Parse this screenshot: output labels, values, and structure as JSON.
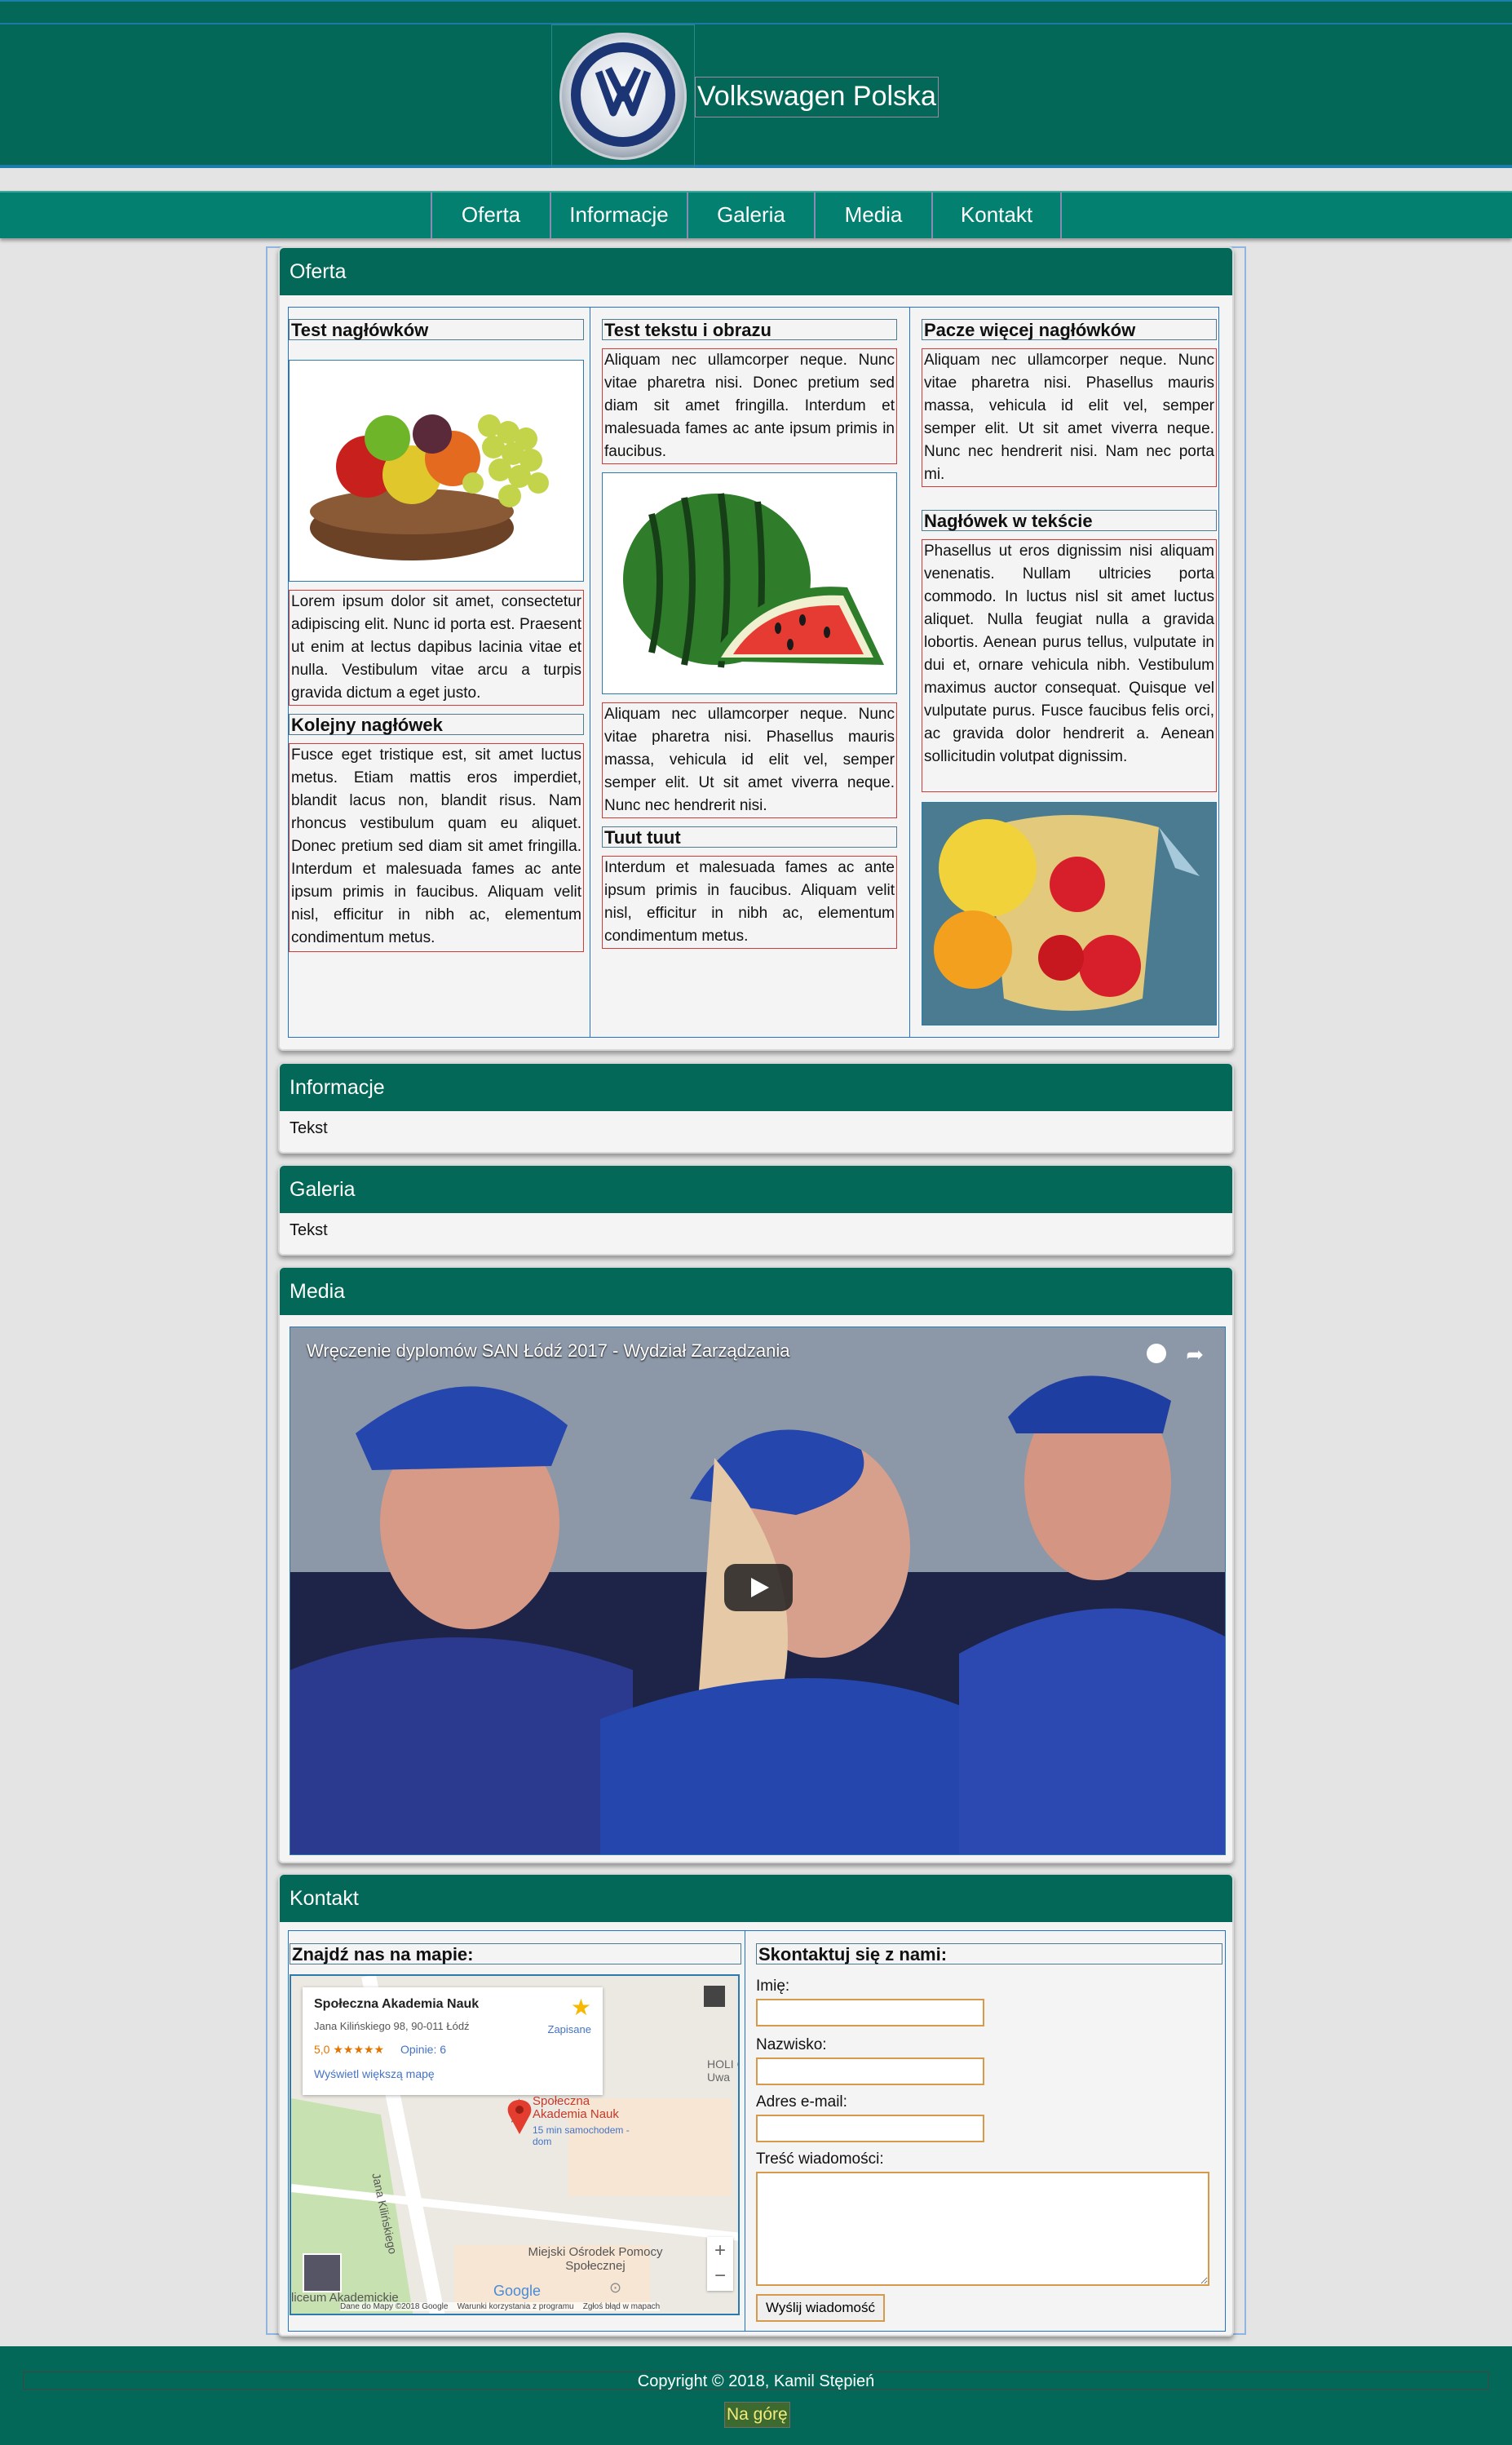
{
  "header": {
    "title": "Volkswagen Polska",
    "logo_letter": "VW"
  },
  "nav": {
    "items": [
      "Oferta",
      "Informacje",
      "Galeria",
      "Media",
      "Kontakt"
    ]
  },
  "oferta": {
    "heading": "Oferta",
    "col1": {
      "h1": "Test nagłówków",
      "p1": "Lorem ipsum dolor sit amet, consectetur adipiscing elit. Nunc id porta est. Praesent ut enim at lectus dapibus lacinia vitae et nulla. Vestibulum vitae arcu a turpis gravida dictum a eget justo.",
      "h2": "Kolejny nagłówek",
      "p2": "Fusce eget tristique est, sit amet luctus metus. Etiam mattis eros imperdiet, blandit lacus non, blandit risus. Nam rhoncus vestibulum quam eu aliquet. Donec pretium sed diam sit amet fringilla. Interdum et malesuada fames ac ante ipsum primis in faucibus. Aliquam velit nisl, efficitur in nibh ac, elementum condimentum metus."
    },
    "col2": {
      "h1": "Test tekstu i obrazu",
      "p1": "Aliquam nec ullamcorper neque. Nunc vitae pharetra nisi. Donec pretium sed diam sit amet fringilla. Interdum et malesuada fames ac ante ipsum primis in faucibus.",
      "p2": "Aliquam nec ullamcorper neque. Nunc vitae pharetra nisi. Phasellus mauris massa, vehicula id elit vel, semper semper elit. Ut sit amet viverra neque. Nunc nec hendrerit nisi.",
      "h2": "Tuut tuut",
      "p3": "Interdum et malesuada fames ac ante ipsum primis in faucibus. Aliquam velit nisl, efficitur in nibh ac, elementum condimentum metus."
    },
    "col3": {
      "h1": "Pacze więcej nagłówków",
      "p1": "Aliquam nec ullamcorper neque. Nunc vitae pharetra nisi. Phasellus mauris massa, vehicula id elit vel, semper semper elit. Ut sit amet viverra neque. Nunc nec hendrerit nisi. Nam nec porta mi.",
      "h2": "Nagłówek w tekście",
      "p2": "Phasellus ut eros dignissim nisi aliquam venenatis. Nullam ultricies porta commodo. In luctus nisl sit amet luctus aliquet. Nulla feugiat nulla a gravida lobortis. Aenean purus tellus, vulputate in dui et, ornare vehicula nibh. Vestibulum maximus auctor consequat. Quisque vel vulputate purus. Fusce faucibus felis orci, ac gravida dolor hendrerit a. Aenean sollicitudin volutpat dignissim."
    }
  },
  "informacje": {
    "heading": "Informacje",
    "text": "Tekst"
  },
  "galeria": {
    "heading": "Galeria",
    "text": "Tekst"
  },
  "media": {
    "heading": "Media",
    "video_title": "Wręczenie dyplomów SAN Łódź 2017 - Wydział Zarządzania"
  },
  "kontakt": {
    "heading": "Kontakt",
    "map_heading": "Znajdź nas na mapie:",
    "form_heading": "Skontaktuj się z nami:",
    "label_name": "Imię:",
    "label_surname": "Nazwisko:",
    "label_email": "Adres e-mail:",
    "label_message": "Treść wiadomości:",
    "submit": "Wyślij wiadomość",
    "map": {
      "place": "Społeczna Akademia Nauk",
      "address": "Jana Kilińskiego 98, 90-011 Łódź",
      "rating": "5,0 ★★★★★",
      "reviews": "Opinie: 6",
      "saved": "Zapisane",
      "bigger_map": "Wyświetl większą mapę",
      "pin_label": "Społeczna Akademia Nauk",
      "pin_sub": "15 min samochodem - dom",
      "street": "Jana Kilińskiego",
      "poi": "Miejski Ośrodek Pomocy Społecznej",
      "poi2": "liceum Akademickie",
      "holi": "HOLI C Uwa",
      "footer_data": "Dane do Mapy ©2018 Google",
      "footer_terms": "Warunki korzystania z programu",
      "footer_report": "Zgłoś błąd w mapach",
      "google": "Google"
    }
  },
  "footer": {
    "copyright": "Copyright © 2018, Kamil Stępień",
    "top_link": "Na górę"
  }
}
